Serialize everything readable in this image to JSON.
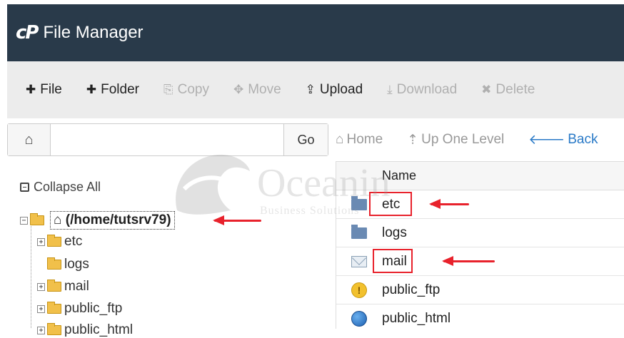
{
  "app": {
    "logo": "cP",
    "title": "File Manager"
  },
  "toolbar": {
    "items": [
      {
        "icon": "plus-icon",
        "glyph": "✚",
        "label": "File",
        "enabled": true
      },
      {
        "icon": "plus-icon",
        "glyph": "✚",
        "label": "Folder",
        "enabled": true
      },
      {
        "icon": "copy-icon",
        "glyph": "⎘",
        "label": "Copy",
        "enabled": false
      },
      {
        "icon": "move-icon",
        "glyph": "✥",
        "label": "Move",
        "enabled": false
      },
      {
        "icon": "upload-icon",
        "glyph": "⇪",
        "label": "Upload",
        "enabled": true
      },
      {
        "icon": "download-icon",
        "glyph": "⤓",
        "label": "Download",
        "enabled": false
      },
      {
        "icon": "delete-icon",
        "glyph": "✖",
        "label": "Delete",
        "enabled": false
      }
    ]
  },
  "pathbar": {
    "value": "",
    "go_label": "Go"
  },
  "nav": {
    "home": "Home",
    "up": "Up One Level",
    "back": "Back"
  },
  "tree": {
    "collapse_label": "Collapse All",
    "root": "(/home/tutsrv79)",
    "children": [
      "etc",
      "logs",
      "mail",
      "public_ftp",
      "public_html"
    ]
  },
  "list": {
    "header": "Name",
    "rows": [
      {
        "name": "etc",
        "icon": "folder-icon"
      },
      {
        "name": "logs",
        "icon": "folder-icon"
      },
      {
        "name": "mail",
        "icon": "mail-icon"
      },
      {
        "name": "public_ftp",
        "icon": "ftp-icon"
      },
      {
        "name": "public_html",
        "icon": "globe-icon"
      }
    ]
  },
  "watermark": {
    "text": "Oceanin",
    "sub": "Business Solutions"
  },
  "colors": {
    "header_bg": "#293a4a",
    "accent": "#2a7ac7",
    "highlight": "#e8222c"
  }
}
